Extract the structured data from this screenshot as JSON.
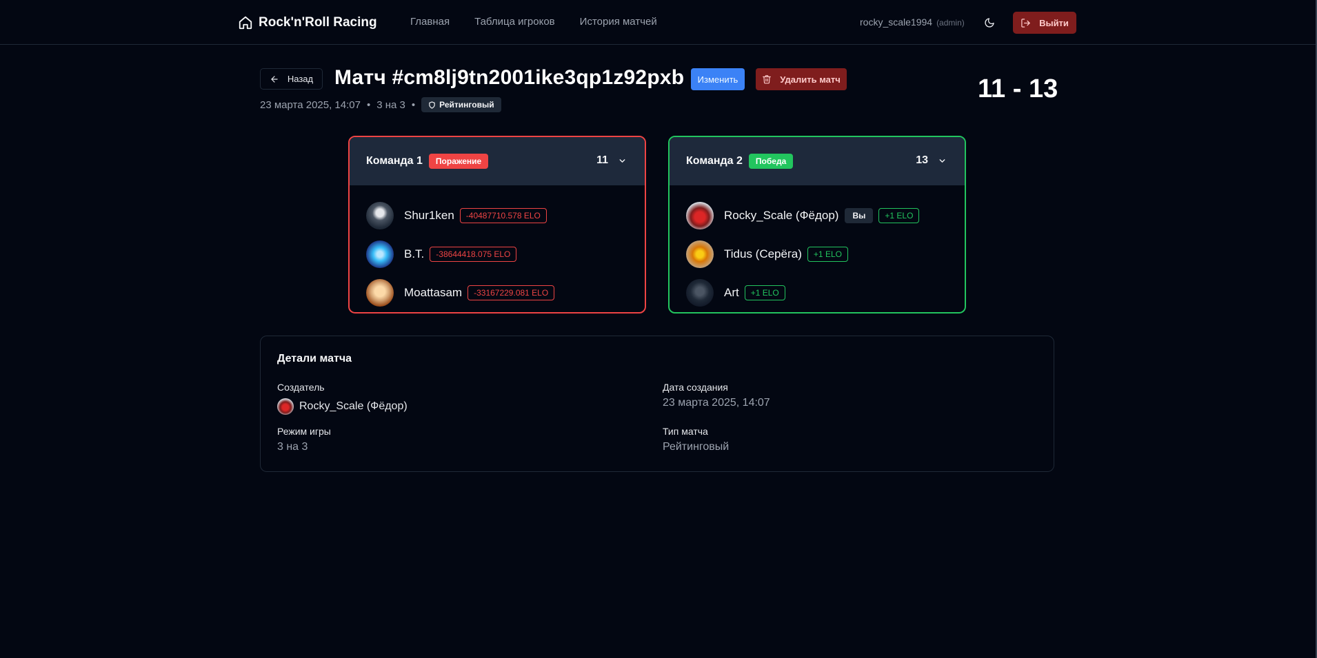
{
  "header": {
    "brand": "Rock'n'Roll Racing",
    "nav": [
      "Главная",
      "Таблица игроков",
      "История матчей"
    ],
    "username": "rocky_scale1994",
    "role": "(admin)",
    "logout_label": "Выйти",
    "icons": {
      "brand": "home-icon",
      "theme": "moon-icon",
      "logout": "log-out-icon"
    }
  },
  "match": {
    "back_label": "Назад",
    "title": "Матч #cm8lj9tn2001ike3qp1z92pxb",
    "edit_label": "Изменить",
    "delete_label": "Удалить матч",
    "score": "11 - 13",
    "date": "23 марта 2025, 14:07",
    "mode": "3 на 3",
    "type_badge": "Рейтинговый"
  },
  "teams": [
    {
      "name": "Команда 1",
      "result": "Поражение",
      "score": "11",
      "color": "#ef4444",
      "players": [
        {
          "name": "Shur1ken",
          "elo": "-40487710.578 ELO"
        },
        {
          "name": "B.T.",
          "elo": "-38644418.075 ELO"
        },
        {
          "name": "Moattasam",
          "elo": "-33167229.081 ELO"
        }
      ]
    },
    {
      "name": "Команда 2",
      "result": "Победа",
      "score": "13",
      "color": "#22c55e",
      "you_label": "Вы",
      "players": [
        {
          "name": "Rocky_Scale (Фёдор)",
          "elo": "+1 ELO"
        },
        {
          "name": "Tidus (Серёга)",
          "elo": "+1 ELO"
        },
        {
          "name": "Art",
          "elo": "+1 ELO"
        }
      ]
    }
  ],
  "details": {
    "title": "Детали матча",
    "creator_label": "Создатель",
    "creator_value": "Rocky_Scale (Фёдор)",
    "created_label": "Дата создания",
    "created_value": "23 марта 2025, 14:07",
    "mode_label": "Режим игры",
    "mode_value": "3 на 3",
    "type_label": "Тип матча",
    "type_value": "Рейтинговый"
  }
}
